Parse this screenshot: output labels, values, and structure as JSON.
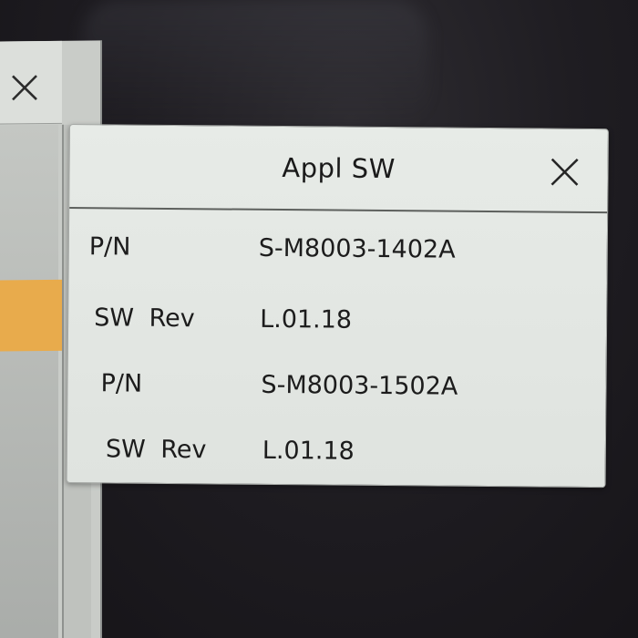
{
  "background_window": {
    "close_icon": "close-icon",
    "highlight_color": "#e8ab4c"
  },
  "dialog": {
    "title": "Appl SW",
    "close_icon": "close-icon",
    "rows": [
      {
        "label": "P/N",
        "value": "S-M8003-1402A"
      },
      {
        "label": "SW Rev",
        "value": "L.01.18"
      },
      {
        "label": "P/N",
        "value": "S-M8003-1502A"
      },
      {
        "label": "SW Rev",
        "value": "L.01.18"
      }
    ]
  }
}
